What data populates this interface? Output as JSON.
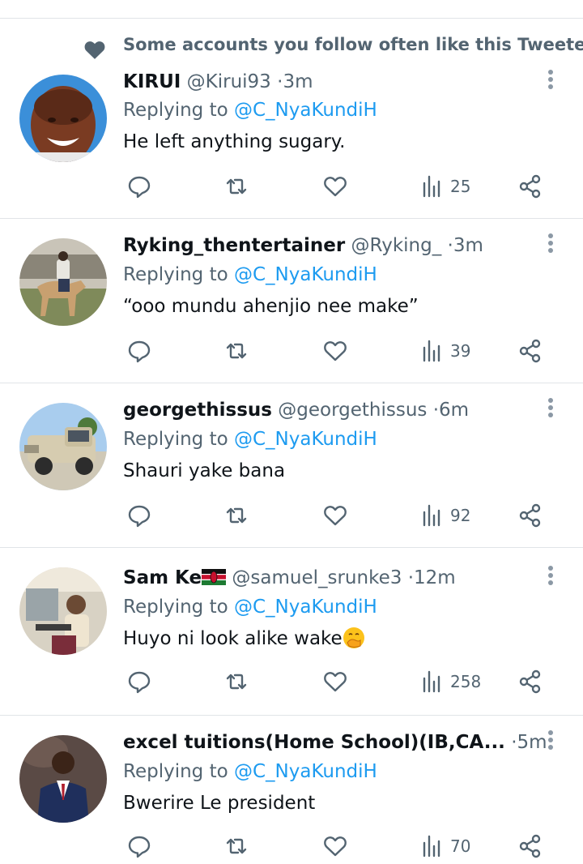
{
  "social_context": {
    "text": "Some accounts you follow often like this Tweeter",
    "icon": "heart-icon"
  },
  "tweets": [
    {
      "name": "KIRUI",
      "handle": "@Kirui93",
      "dot": "·",
      "time": "3m",
      "replying_label": "Replying to",
      "replying_to": "@C_NyaKundiH",
      "text": "He left anything sugary.",
      "views": "25"
    },
    {
      "name": "Ryking_thentertainer",
      "handle": "@Ryking_",
      "dot": "·",
      "time": "3m",
      "replying_label": "Replying to",
      "replying_to": "@C_NyaKundiH",
      "text": "“ooo mundu ahenjio nee make”",
      "views": "39"
    },
    {
      "name": "georgethissus",
      "handle": "@georgethissus",
      "dot": "·",
      "time": "6m",
      "replying_label": "Replying to",
      "replying_to": "@C_NyaKundiH",
      "text": "Shauri yake bana",
      "views": "92"
    },
    {
      "name": "Sam Ke",
      "handle": "@samuel_srunke3",
      "dot": "·",
      "time": "12m",
      "replying_label": "Replying to",
      "replying_to": "@C_NyaKundiH",
      "text": "Huyo ni look alike wake",
      "views": "258"
    },
    {
      "name": "excel tuitions(Home School)(IB,CA...",
      "handle": "",
      "dot": "·",
      "time": "5m",
      "replying_label": "Replying to",
      "replying_to": "@C_NyaKundiH",
      "text": "Bwerire Le president",
      "views": "70"
    }
  ],
  "colors": {
    "link": "#1d9bf0",
    "muted": "#536471",
    "text": "#0f1419",
    "divider": "#e1e4e8"
  }
}
